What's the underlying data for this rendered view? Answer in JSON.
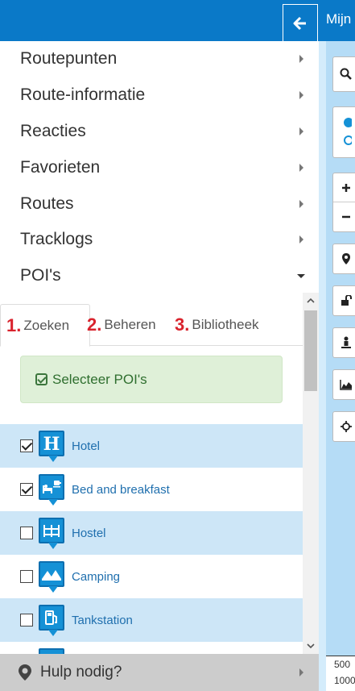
{
  "header": {
    "back_icon": "arrow-left-icon",
    "right_text": "Mijn"
  },
  "menu": {
    "items": [
      {
        "label": "Routepunten",
        "expanded": false
      },
      {
        "label": "Route-informatie",
        "expanded": false
      },
      {
        "label": "Reacties",
        "expanded": false
      },
      {
        "label": "Favorieten",
        "expanded": false
      },
      {
        "label": "Routes",
        "expanded": false
      },
      {
        "label": "Tracklogs",
        "expanded": false
      },
      {
        "label": "POI's",
        "expanded": true
      }
    ]
  },
  "poi_panel": {
    "tabs": [
      {
        "number": "1.",
        "label": "Zoeken",
        "active": true
      },
      {
        "number": "2.",
        "label": "Beheren",
        "active": false
      },
      {
        "number": "3.",
        "label": "Bibliotheek",
        "active": false
      }
    ],
    "select_button": "Selecteer POI's",
    "items": [
      {
        "label": "Hotel",
        "checked": true,
        "icon": "hotel-icon"
      },
      {
        "label": "Bed and breakfast",
        "checked": true,
        "icon": "bed-and-breakfast-icon"
      },
      {
        "label": "Hostel",
        "checked": false,
        "icon": "hostel-icon"
      },
      {
        "label": "Camping",
        "checked": false,
        "icon": "camping-icon"
      },
      {
        "label": "Tankstation",
        "checked": false,
        "icon": "fuel-station-icon"
      }
    ]
  },
  "help": {
    "label": "Hulp nodig?",
    "icon": "help-marker-icon"
  },
  "map": {
    "scale_labels": [
      "500",
      "1000"
    ]
  },
  "colors": {
    "header_blue": "#0a79c8",
    "highlight_row": "#cde6f7",
    "tab_number_red": "#d9232d",
    "success_bg": "#dff0d8",
    "link_blue": "#1f6fae",
    "poi_marker_blue": "#1591d6"
  }
}
